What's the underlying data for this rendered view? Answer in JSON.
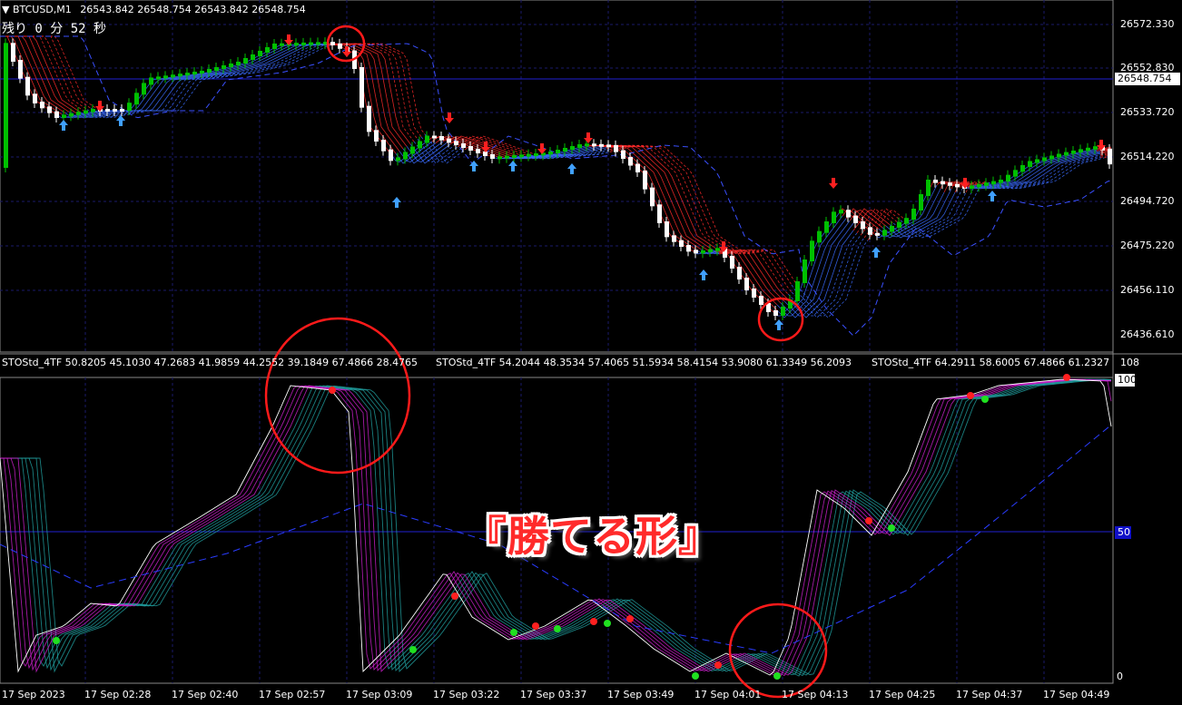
{
  "header": {
    "symbol": "BTCUSD,M1",
    "ohlc": "26543.842 26548.754 26543.842 26548.754",
    "timer": "残り 0 分 52 秒"
  },
  "price_axis": {
    "labels": [
      "26572.330",
      "26552.830",
      "26533.720",
      "26514.220",
      "26494.720",
      "26475.220",
      "26456.110",
      "26436.610"
    ],
    "current": "26548.754"
  },
  "indicator": {
    "readouts": [
      "STOStd_4TF 50.8205 45.1030 47.2683 41.9859 44.2552 39.1849 67.4866 28.4765",
      "STOStd_4TF 54.2044 48.3534 57.4065 51.5934 58.4154 53.9080 61.3349 56.2093",
      "STOStd_4TF 64.2911 58.6005 67.4866 61.2327"
    ],
    "max_label": "108",
    "level_100": "100",
    "level_50": "50",
    "level_0": "0"
  },
  "time_axis": [
    "17 Sep 2023",
    "17 Sep 02:28",
    "17 Sep 02:40",
    "17 Sep 02:57",
    "17 Sep 03:09",
    "17 Sep 03:22",
    "17 Sep 03:37",
    "17 Sep 03:49",
    "17 Sep 04:01",
    "17 Sep 04:13",
    "17 Sep 04:25",
    "17 Sep 04:37",
    "17 Sep 04:49"
  ],
  "annotation": {
    "headline": "『勝てる形』",
    "circle_color": "#ff1a1a"
  },
  "colors": {
    "up_candle": "#00c000",
    "down_candle": "#ffffff",
    "ribbon_down": "#ff2a2a",
    "ribbon_up": "#3a6bff",
    "stoch_fast": "#ffffff",
    "stoch_mid": "#d020d0",
    "stoch_slow": "#20a0a0",
    "grid": "#1a1a6a"
  }
}
